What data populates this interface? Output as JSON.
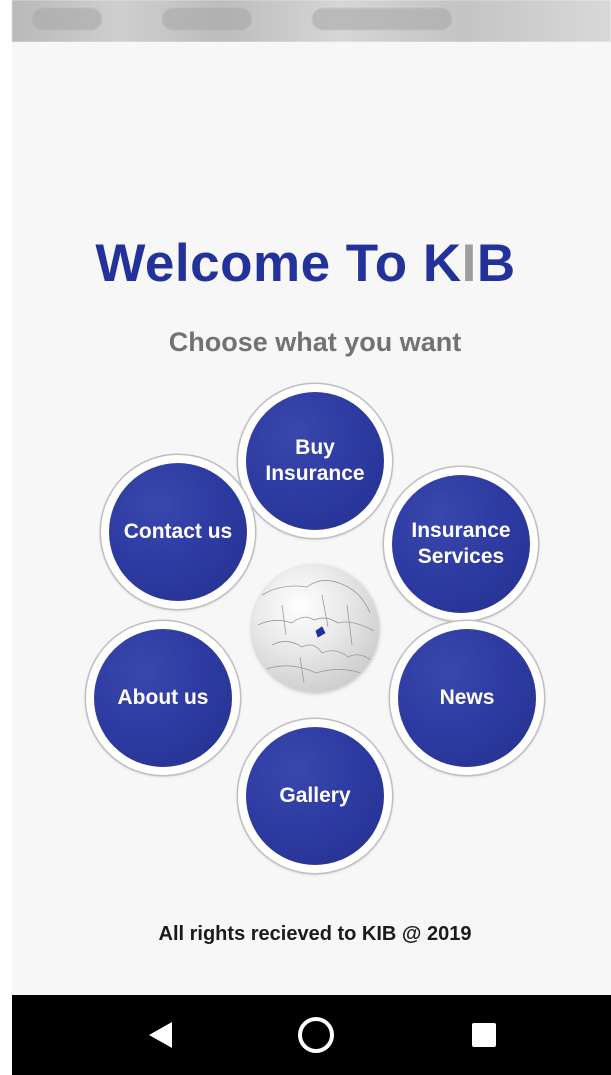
{
  "header": {
    "title_main": "Welcome To K",
    "title_accent": "I",
    "title_end": "B",
    "subtitle": "Choose what you want"
  },
  "menu": {
    "buy_insurance": "Buy\nInsurance",
    "contact_us": "Contact us",
    "insurance_services": "Insurance\nServices",
    "about_us": "About us",
    "news": "News",
    "gallery": "Gallery"
  },
  "footer": {
    "text": "All rights recieved to KIB @ 2019"
  },
  "icons": {
    "globe": "globe-icon",
    "back": "back-icon",
    "home": "home-icon",
    "recents": "recents-icon"
  },
  "colors": {
    "brand_blue": "#23319a",
    "accent_gray": "#9e9e9e",
    "subtitle_gray": "#727272"
  }
}
